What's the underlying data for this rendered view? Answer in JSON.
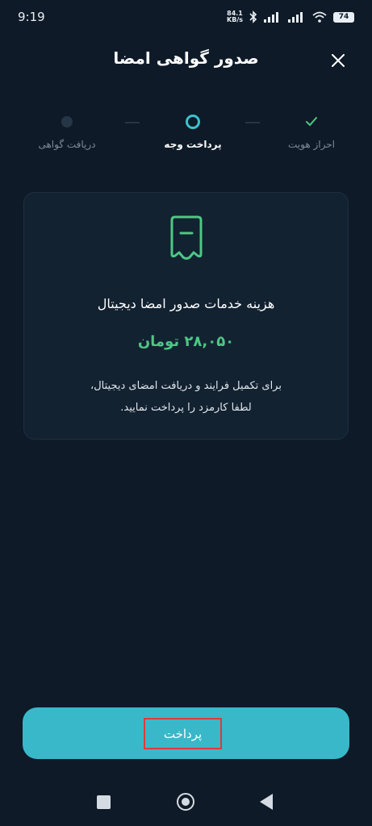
{
  "status_bar": {
    "time": "9:19",
    "net_speed_value": "84.1",
    "net_speed_unit": "KB/s",
    "battery": "74"
  },
  "header": {
    "title": "صدور گواهی امضا"
  },
  "stepper": {
    "steps": [
      {
        "label": "احراز هویت",
        "state": "done"
      },
      {
        "label": "پرداخت وجه",
        "state": "active"
      },
      {
        "label": "دریافت گواهی",
        "state": "pending"
      }
    ]
  },
  "card": {
    "icon": "receipt-icon",
    "title": "هزینه خدمات صدور امضا دیجیتال",
    "amount": "۲۸,۰۵۰ تومان",
    "description_line1": "برای تکمیل فرایند و دریافت امضای دیجیتال،",
    "description_line2": "لطفا کارمزد را پرداخت نمایید."
  },
  "pay_button": {
    "label": "پرداخت"
  },
  "colors": {
    "background": "#0e1a27",
    "accent": "#38b8c9",
    "amount": "#4dc785",
    "success": "#4dc785"
  }
}
